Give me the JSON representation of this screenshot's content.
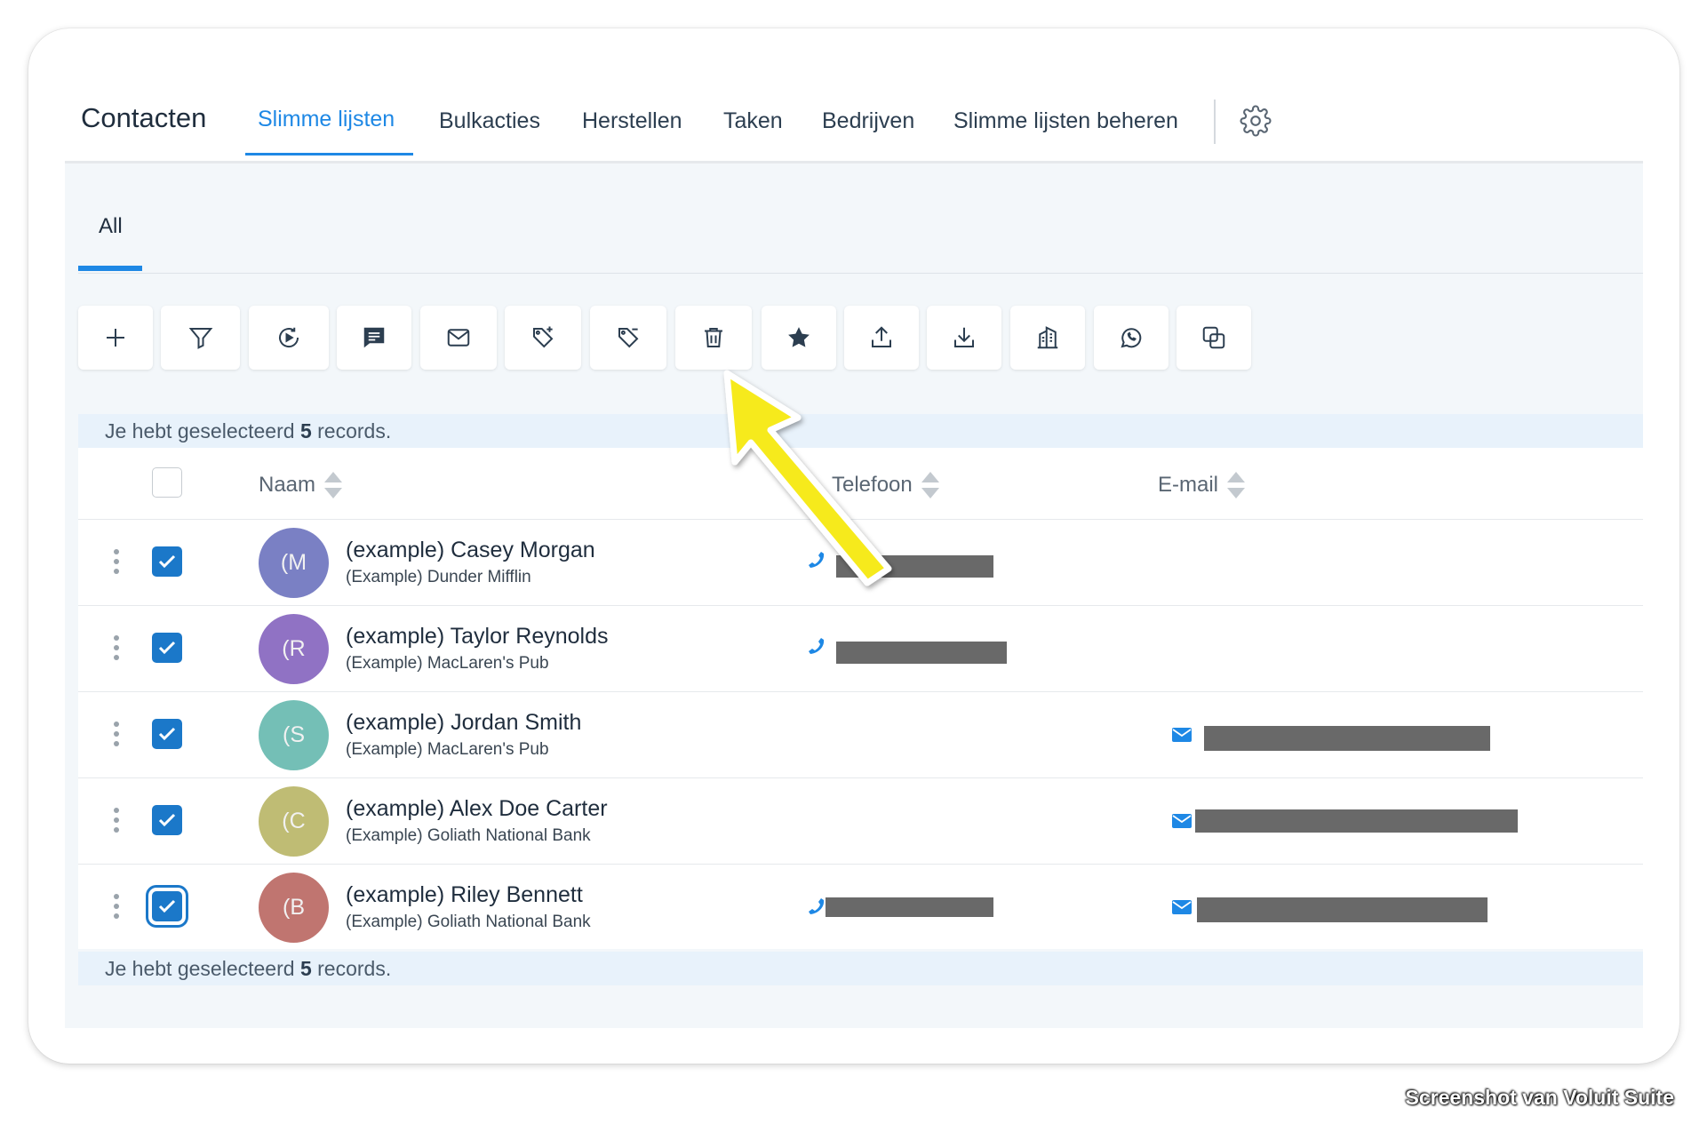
{
  "app_title": "Contacten",
  "tabs": [
    {
      "label": "Slimme lijsten",
      "active": true
    },
    {
      "label": "Bulkacties"
    },
    {
      "label": "Herstellen"
    },
    {
      "label": "Taken"
    },
    {
      "label": "Bedrijven"
    },
    {
      "label": "Slimme lijsten beheren"
    }
  ],
  "subtab": "All",
  "toolbar": [
    "add-icon",
    "filter-icon",
    "workflow-icon",
    "sms-icon",
    "email-icon",
    "tag-add-icon",
    "tag-remove-icon",
    "trash-icon",
    "star-icon",
    "export-icon",
    "import-icon",
    "company-icon",
    "whatsapp-icon",
    "merge-icon"
  ],
  "selection": {
    "prefix": "Je hebt geselecteerd ",
    "count": "5",
    "suffix": " records."
  },
  "columns": {
    "name": "Naam",
    "phone": "Telefoon",
    "email": "E-mail"
  },
  "rows": [
    {
      "initials": "(M",
      "name": "(example) Casey Morgan",
      "company": "(Example) Dunder Mifflin",
      "avatar_color": "#7a80c4",
      "has_phone": true,
      "has_email": false
    },
    {
      "initials": "(R",
      "name": "(example) Taylor Reynolds",
      "company": "(Example) MacLaren's Pub",
      "avatar_color": "#9072c4",
      "has_phone": true,
      "has_email": false
    },
    {
      "initials": "(S",
      "name": "(example) Jordan Smith",
      "company": "(Example) MacLaren's Pub",
      "avatar_color": "#74bfb6",
      "has_phone": false,
      "has_email": true
    },
    {
      "initials": "(C",
      "name": "(example) Alex Doe Carter",
      "company": "(Example) Goliath National Bank",
      "avatar_color": "#bfbc74",
      "has_phone": false,
      "has_email": true
    },
    {
      "initials": "(B",
      "name": "(example) Riley Bennett",
      "company": "(Example) Goliath National Bank",
      "avatar_color": "#c07570",
      "has_phone": true,
      "has_email": true
    }
  ],
  "watermark": "Screenshot van Voluit Suite",
  "colors": {
    "accent": "#1e88e5",
    "checkbox": "#1b78c9",
    "arrow": "#f6ea1c"
  }
}
